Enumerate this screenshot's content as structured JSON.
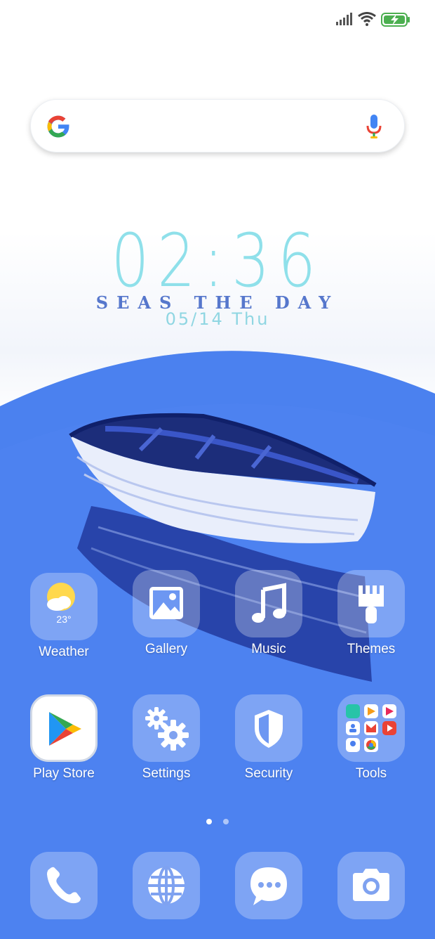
{
  "status_bar": {
    "icons": [
      "cellular-signal-icon",
      "wifi-icon",
      "battery-charging-icon"
    ],
    "battery_color": "#4caf50"
  },
  "search_bar": {
    "logo": "google-g-icon",
    "mic": "microphone-icon"
  },
  "clock_widget": {
    "time": "02:36",
    "tagline": "SEAS THE DAY",
    "date": "05/14 Thu"
  },
  "wallpaper": {
    "accent": "#4a7ff0",
    "subject": "boat"
  },
  "home_apps": [
    {
      "label": "Weather",
      "icon": "weather-icon",
      "temp": "23°"
    },
    {
      "label": "Gallery",
      "icon": "gallery-icon"
    },
    {
      "label": "Music",
      "icon": "music-note-icon"
    },
    {
      "label": "Themes",
      "icon": "paintbrush-icon"
    },
    {
      "label": "Play Store",
      "icon": "play-store-icon"
    },
    {
      "label": "Settings",
      "icon": "gears-icon"
    },
    {
      "label": "Security",
      "icon": "shield-icon"
    },
    {
      "label": "Tools",
      "icon": "folder-icon"
    }
  ],
  "page_indicator": {
    "pages": 2,
    "active": 1
  },
  "dock": [
    {
      "icon": "phone-icon"
    },
    {
      "icon": "globe-icon"
    },
    {
      "icon": "messages-icon"
    },
    {
      "icon": "camera-icon"
    }
  ]
}
